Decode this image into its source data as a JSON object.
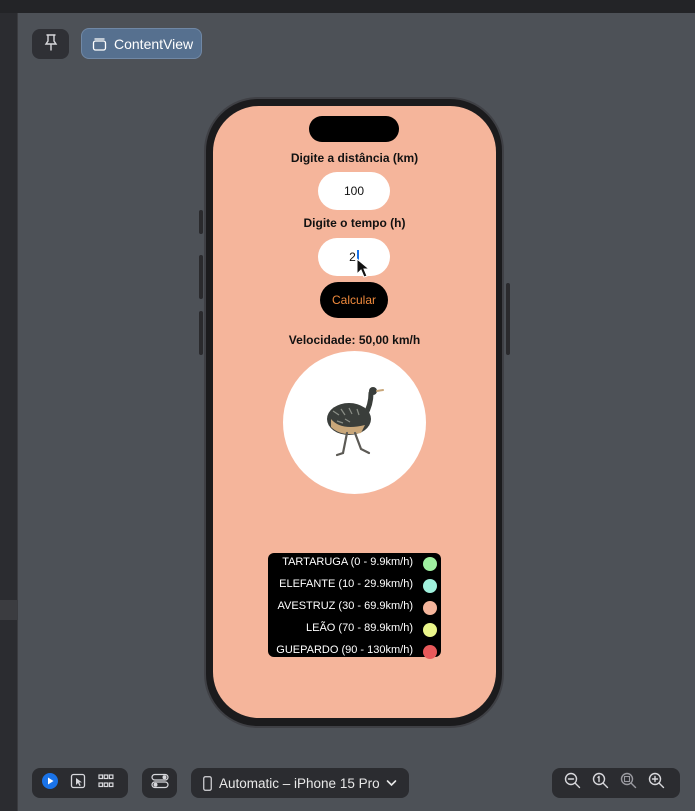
{
  "toolbar": {
    "pin_icon": "pin-icon",
    "preview_button_label": "ContentView",
    "preview_icon": "stack-icon"
  },
  "app": {
    "distance_label": "Digite a distância (km)",
    "distance_value": "100",
    "time_label": "Digite o tempo (h)",
    "time_value": "2",
    "calculate_label": "Calcular",
    "result": "Velocidade: 50,00 km/h",
    "animal_image": "emu-illustration"
  },
  "legend": [
    {
      "label": "TARTARUGA (0 - 9.9km/h)",
      "color": "#9ff0a0"
    },
    {
      "label": "ELEFANTE (10 - 29.9km/h)",
      "color": "#a0f0dc"
    },
    {
      "label": "AVESTRUZ (30 - 69.9km/h)",
      "color": "#f5b59b"
    },
    {
      "label": "LEÃO (70 - 89.9km/h)",
      "color": "#eaf58a"
    },
    {
      "label": "GUEPARDO (90 - 130km/h)",
      "color": "#e8595a"
    }
  ],
  "bottom_bar": {
    "device_label": "Automatic – iPhone 15 Pro",
    "icons": [
      "play-icon",
      "select-icon",
      "grid-icon",
      "settings-toggle-icon",
      "zoom-out-icon",
      "zoom-actual-icon",
      "zoom-fit-icon",
      "zoom-in-icon"
    ]
  },
  "colors": {
    "screen_bg": "#f5b59b",
    "accent_orange": "#f08a3c",
    "active_blue": "#1a73e8"
  }
}
